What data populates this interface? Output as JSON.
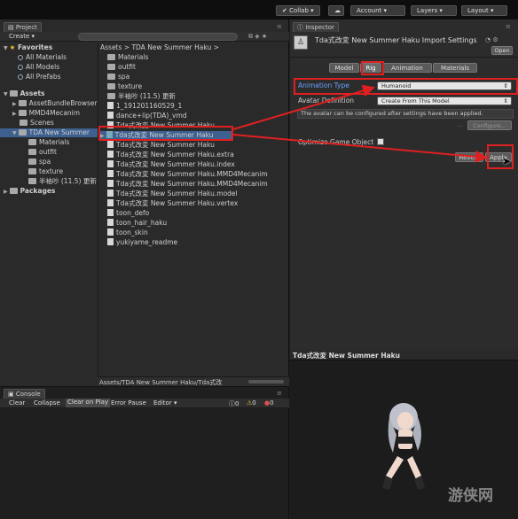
{
  "toolbar": {
    "collab": "Collab",
    "account": "Account",
    "layers": "Layers",
    "layout": "Layout"
  },
  "project": {
    "tab": "Project",
    "create": "Create",
    "breadcrumb": "Assets > TDA New Summer Haku >",
    "favorites": {
      "title": "Favorites",
      "items": [
        "All Materials",
        "All Models",
        "All Prefabs"
      ]
    },
    "assets": {
      "title": "Assets",
      "items": [
        "AssetBundleBrowser",
        "MMD4Mecanim",
        "Scenes",
        "TDA New Summer"
      ],
      "children": [
        "Materials",
        "outfit",
        "spa",
        "texture",
        "半袖吵 (11.5) 更新"
      ]
    },
    "packages": "Packages",
    "files": [
      "Materials",
      "outfit",
      "spa",
      "texture",
      "半袖吵 (11.5) 更新",
      "1_191201160529_1",
      "dance+lip(TDA)_vmd",
      "Tda式改変 New Summer Haku",
      "Tda式改変 New Summer Haku",
      "Tda式改変 New Summer Haku",
      "Tda式改変 New Summer Haku.extra",
      "Tda式改変 New Summer Haku.index",
      "Tda式改変 New Summer Haku.MMD4Mecanim",
      "Tda式改変 New Summer Haku.MMD4Mecanim",
      "Tda式改変 New Summer Haku.model",
      "Tda式改変 New Summer Haku.vertex",
      "toon_defo",
      "toon_hair_haku",
      "toon_skin",
      "yukiyame_readme"
    ],
    "status": "Assets/TDA New Summer Haku/Tda式改"
  },
  "console": {
    "tab": "Console",
    "buttons": [
      "Clear",
      "Collapse",
      "Clear on Play",
      "Error Pause",
      "Editor"
    ],
    "counts": [
      "0",
      "0",
      "0"
    ]
  },
  "inspector": {
    "tab": "Inspector",
    "title": "Tda式改変 New Summer Haku Import Settings",
    "open": "Open",
    "tabs": [
      "Model",
      "Rig",
      "Animation",
      "Materials"
    ],
    "animation_type_label": "Animation Type",
    "animation_type_value": "Humanoid",
    "avatar_def_label": "Avatar Definition",
    "avatar_def_value": "Create From This Model",
    "info": "The avatar can be configured after settings have been applied.",
    "configure": "Configure...",
    "optimize": "Optimize Game Object",
    "revert": "Revert",
    "apply": "Apply",
    "preview_title": "Tda式改変 New Summer Haku"
  },
  "watermark": "游侠网"
}
